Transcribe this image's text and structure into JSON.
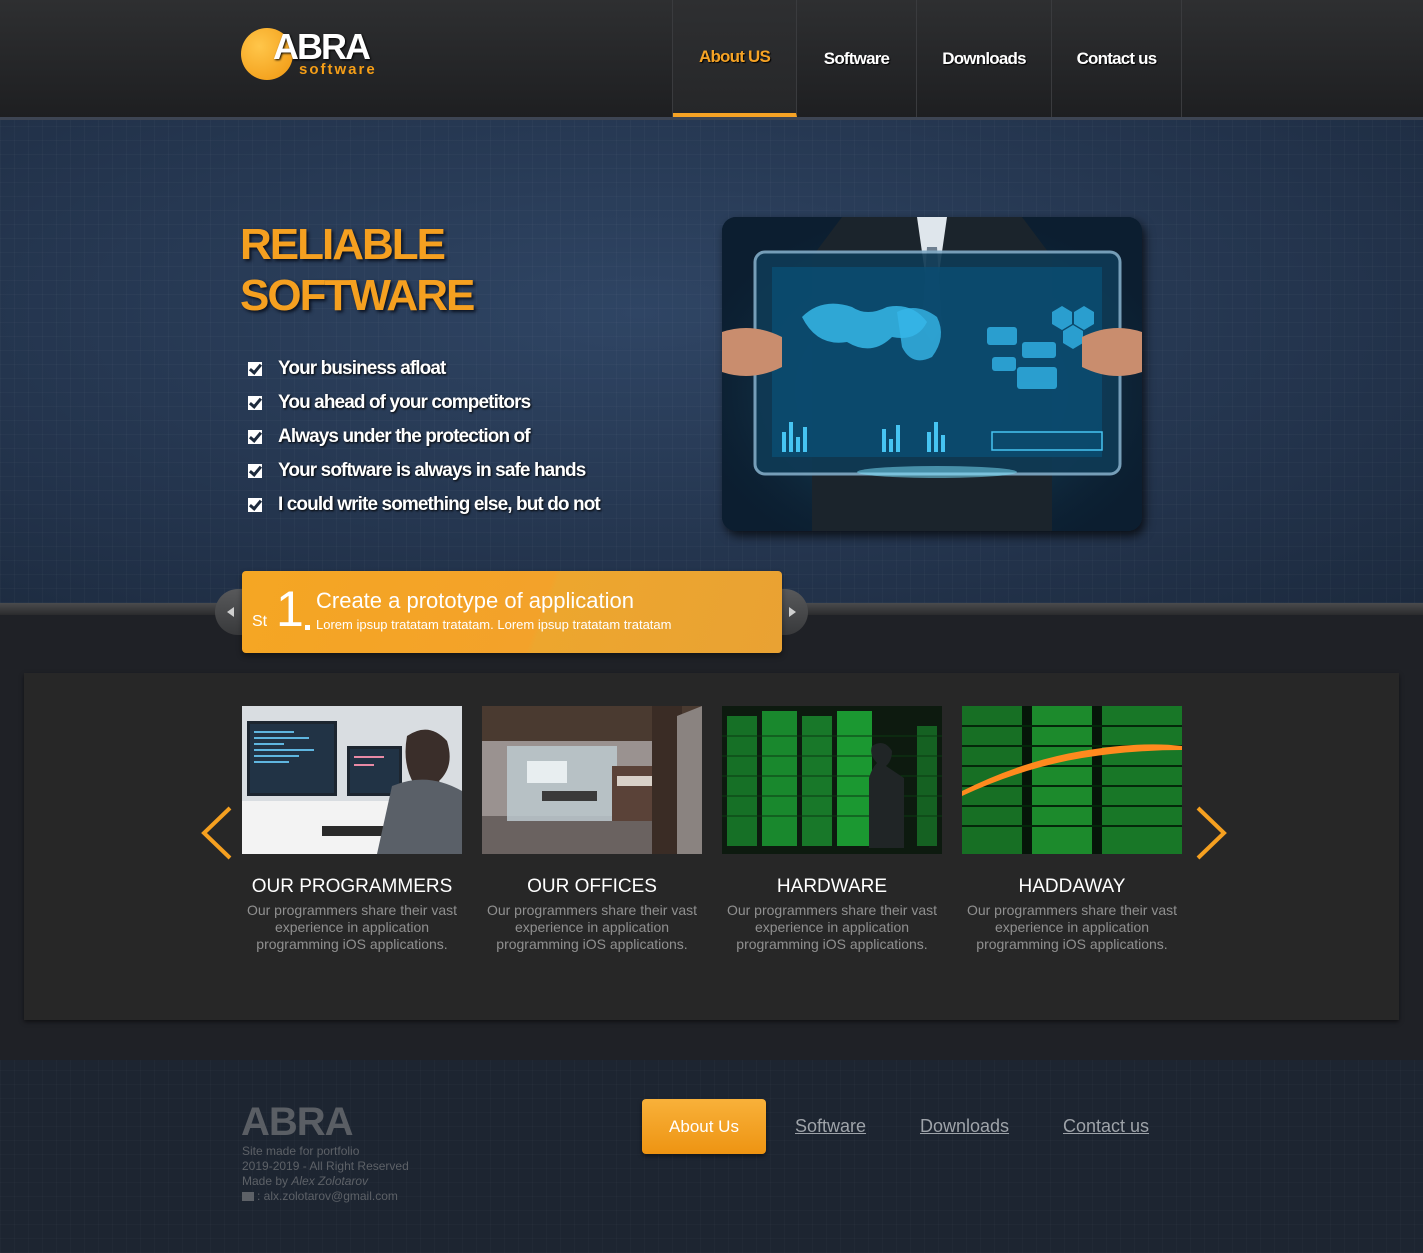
{
  "brand": {
    "name": "ABRA",
    "tagline": "software"
  },
  "nav": [
    {
      "label": "About US",
      "active": true
    },
    {
      "label": "Software"
    },
    {
      "label": "Downloads"
    },
    {
      "label": "Contact us"
    }
  ],
  "hero": {
    "title_line1": "RELIABLE",
    "title_line2": "SOFTWARE",
    "features": [
      "Your business afloat",
      "You ahead of your competitors",
      "Always under the protection of",
      "Your software is always in safe hands",
      "I could write something else, but do not"
    ]
  },
  "step": {
    "prefix": "St",
    "number": "1",
    "title": "Create a prototype of application",
    "text": "Lorem ipsup tratatam tratatam. Lorem ipsup tratatam tratatam"
  },
  "cards": [
    {
      "title": "OUR PROGRAMMERS",
      "text": "Our programmers share their vast experience in application programming iOS applications."
    },
    {
      "title": "OUR OFFICES",
      "text": "Our programmers share their vast experience in application programming iOS applications."
    },
    {
      "title": "HARDWARE",
      "text": "Our programmers share their vast experience in application programming iOS applications."
    },
    {
      "title": "HADDAWAY",
      "text": "Our programmers share their vast experience in application programming iOS applications."
    }
  ],
  "footer": {
    "brand": "ABRA",
    "line1": "Site made for portfolio",
    "line2": "2019-2019 - All Right Reserved",
    "made_by_prefix": "Made by ",
    "author": "Alex Zolotarov",
    "email": ": alx.zolotarov@gmail.com",
    "button": "About Us",
    "links": [
      "Software",
      "Downloads",
      "Contact us"
    ]
  },
  "colors": {
    "accent": "#f5a020",
    "header_bg": "#2a2b2d",
    "hero_bg": "#263853",
    "panel_bg": "#272727",
    "footer_bg": "#1d2531"
  }
}
